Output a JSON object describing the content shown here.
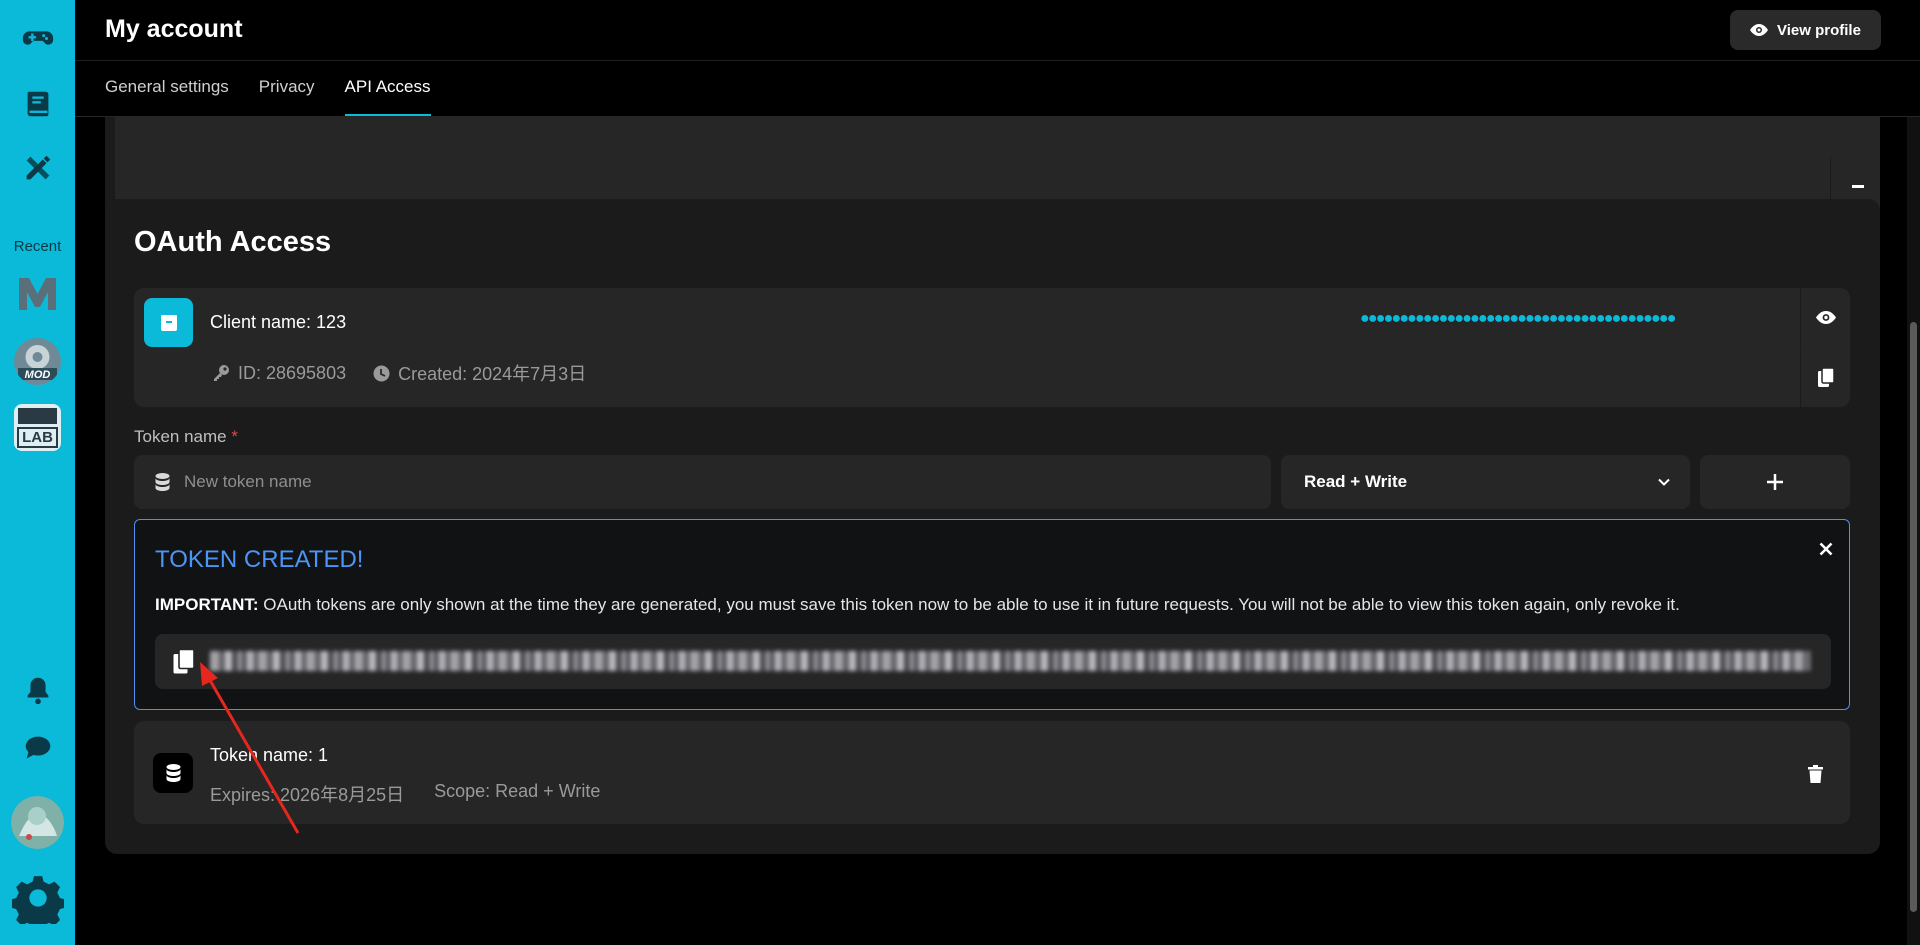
{
  "header": {
    "title": "My account",
    "view_profile_label": "View profile"
  },
  "tabs": [
    {
      "label": "General settings",
      "active": false
    },
    {
      "label": "Privacy",
      "active": false
    },
    {
      "label": "API Access",
      "active": true
    }
  ],
  "rail": {
    "recent_label": "Recent",
    "icons": [
      "gamepad-icon",
      "book-icon",
      "pencil-ruler-icon",
      "bell-icon",
      "chat-icon",
      "avatar",
      "settings-gear-icon"
    ],
    "recent_items": [
      "recent-m",
      "recent-mod",
      "recent-lab"
    ],
    "mod_thumb_text": "MOD",
    "lab_thumb_text": "LAB"
  },
  "oauth": {
    "title": "OAuth Access",
    "client": {
      "name": "Client name: 123",
      "id": "ID: 28695803",
      "created": "Created: 2024年7月3日",
      "secret_masked": "●●●●●●●●●●●●●●●●●●●●●●●●●●●●●●●●●●●●●●●●"
    },
    "token_form": {
      "label": "Token name",
      "required_mark": "*",
      "placeholder": "New token name",
      "scope_selected": "Read + Write"
    },
    "created_notice": {
      "title": "TOKEN CREATED!",
      "important_label": "IMPORTANT:",
      "message": " OAuth tokens are only shown at the time they are generated, you must save this token now to be able to use it in future requests. You will not be able to view this token again, only revoke it."
    },
    "tokens": [
      {
        "name": "Token name: 1",
        "expires": "Expires: 2026年8月25日",
        "scope": "Scope: Read + Write"
      }
    ]
  },
  "colors": {
    "accent": "#0bb9d9",
    "notice_border": "#4d8ff0",
    "notice_title": "#4d95f5",
    "annotation": "#e5271e"
  }
}
